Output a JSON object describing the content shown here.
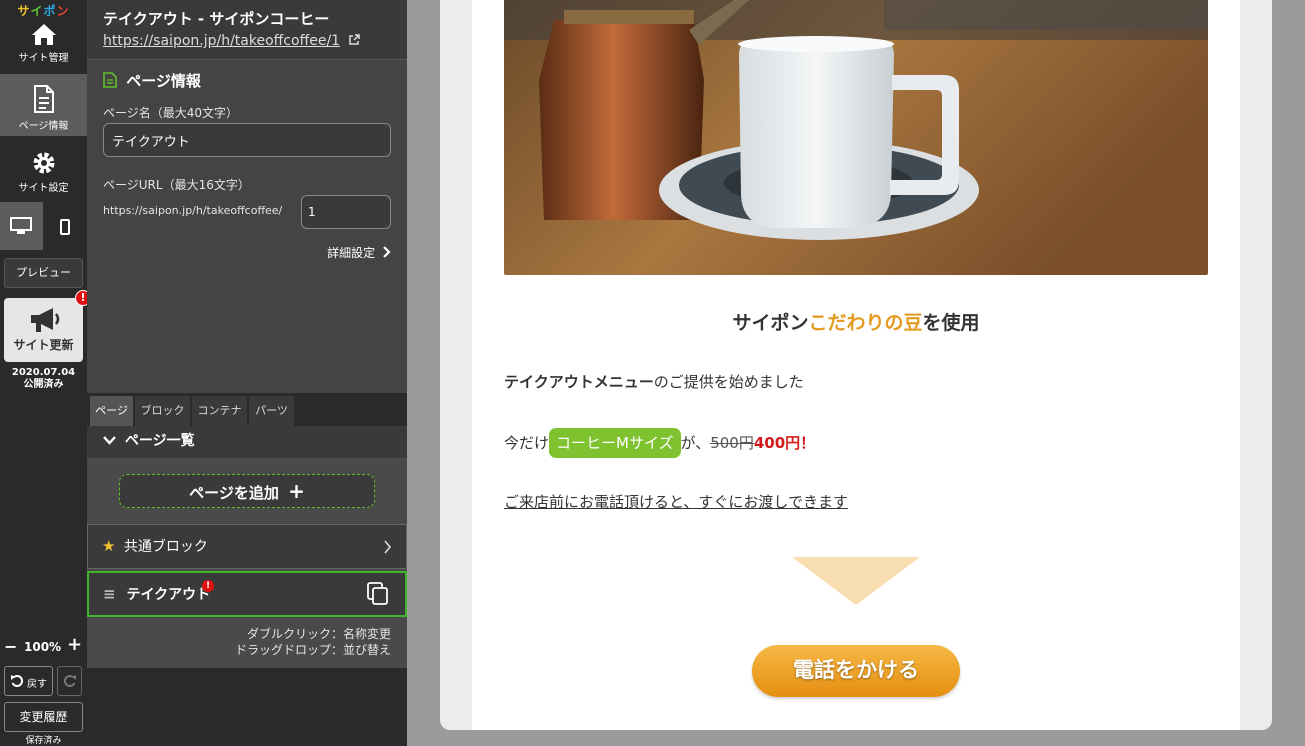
{
  "rail": {
    "logo": "サイポン",
    "site_admin": "サイト管理",
    "page_info": "ページ情報",
    "site_settings": "サイト設定",
    "preview": "プレビュー",
    "site_update": "サイト更新",
    "update_badge": "!",
    "update_date": "2020.07.04",
    "update_status": "公開済み",
    "zoom": "100%",
    "undo": "戻す",
    "history": "変更履歴",
    "saved": "保存済み"
  },
  "panel": {
    "site_title": "テイクアウト - サイポンコーヒー",
    "site_url": "https://saipon.jp/h/takeoffcoffee/1",
    "section_title": "ページ情報",
    "page_name_label": "ページ名（最大40文字）",
    "page_name_value": "テイクアウト",
    "page_url_label": "ページURL（最大16文字）",
    "url_prefix": "https://saipon.jp/h/takeoffcoffee/",
    "url_slug": "1",
    "detail_settings": "詳細設定",
    "tabs": [
      {
        "label": "ページ"
      },
      {
        "label": "ブロック"
      },
      {
        "label": "コンテナ"
      },
      {
        "label": "パーツ"
      }
    ],
    "page_list_title": "ページ一覧",
    "add_page": "ページを追加",
    "common_block": "共通ブロック",
    "takeout_page": "テイクアウト",
    "takeout_badge": "!",
    "hint_dblclick": "ダブルクリック：名称変更",
    "hint_drag": "ドラッグドロップ：並び替え"
  },
  "preview": {
    "headline_pre": "サイポン",
    "headline_accent": "こだわりの豆",
    "headline_post": "を使用",
    "line1_bold": "テイクアウトメニュー",
    "line1_rest": "のご提供を始めました",
    "line2_pre": "今だけ",
    "line2_pill": "コーヒーMサイズ",
    "line2_mid": "が、",
    "price_old": "500円",
    "price_new": "400円！",
    "line3": "ご来店前にお電話頂けると、すぐにお渡しできます",
    "call_button": "電話をかける"
  },
  "colors": {
    "accent_green": "#3fb52a",
    "pill_green": "#7fc22f",
    "headline_orange": "#e49a1f",
    "price_red": "#d21c1c",
    "button_orange": "#e58f10"
  }
}
